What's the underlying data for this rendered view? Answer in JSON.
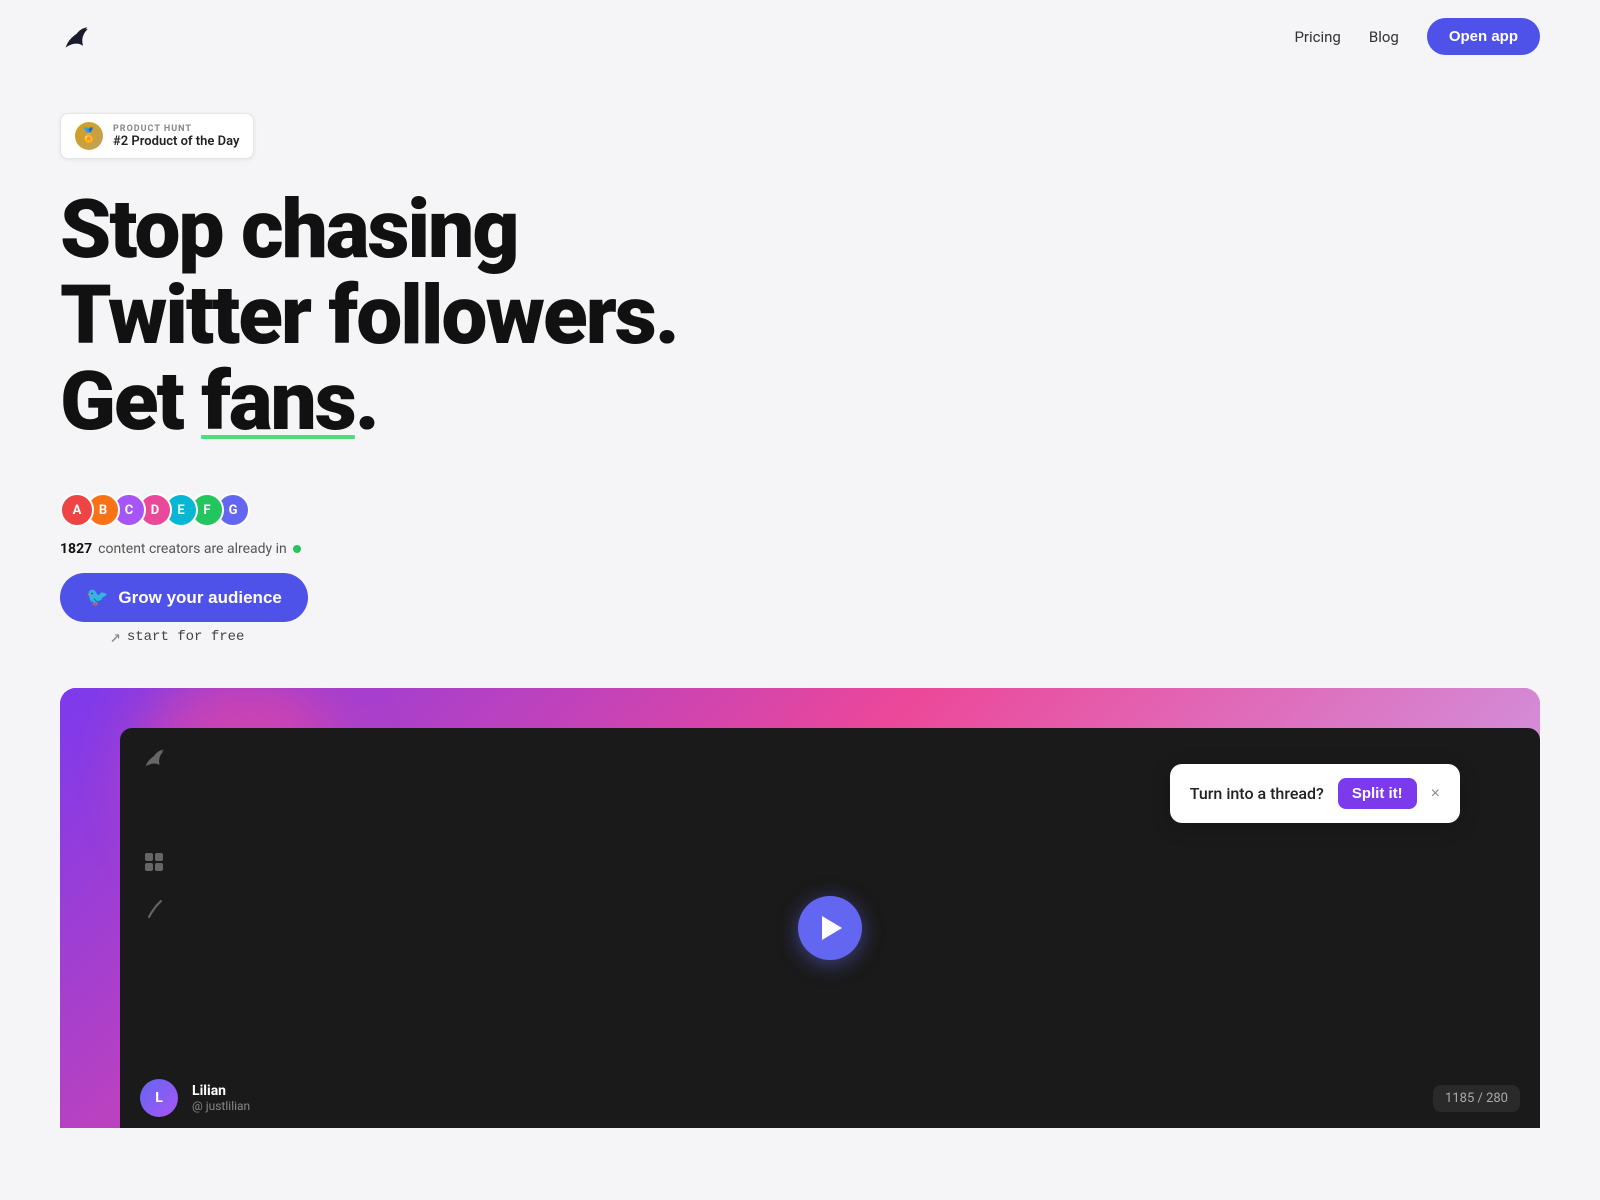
{
  "nav": {
    "pricing_label": "Pricing",
    "blog_label": "Blog",
    "open_app_label": "Open app"
  },
  "badge": {
    "label": "PRODUCT HUNT",
    "value": "#2 Product of the Day"
  },
  "hero": {
    "heading_line1": "Stop chasing",
    "heading_line2": "Twitter followers.",
    "heading_line3_pre": "Get ",
    "heading_fans": "fans",
    "heading_line3_post": "."
  },
  "social_proof": {
    "count": "1827",
    "text": "content creators are already in"
  },
  "cta": {
    "grow_label": "Grow your audience",
    "start_free": "start for free"
  },
  "toast": {
    "message": "Turn into a thread?",
    "split_label": "Split it!",
    "close_label": "×"
  },
  "bottom_bar": {
    "user_name": "Lilian",
    "user_handle": "@ justlilian",
    "char_count": "1185 / 280"
  },
  "colors": {
    "accent_purple": "#4f52e8",
    "fans_underline": "#4ade80",
    "split_btn": "#7c3aed",
    "play_btn": "#6366f1"
  },
  "avatars": [
    {
      "color": "#ef4444",
      "initials": "A"
    },
    {
      "color": "#f97316",
      "initials": "B"
    },
    {
      "color": "#a855f7",
      "initials": "C"
    },
    {
      "color": "#ec4899",
      "initials": "D"
    },
    {
      "color": "#06b6d4",
      "initials": "E"
    },
    {
      "color": "#22c55e",
      "initials": "F"
    },
    {
      "color": "#6366f1",
      "initials": "G"
    }
  ]
}
